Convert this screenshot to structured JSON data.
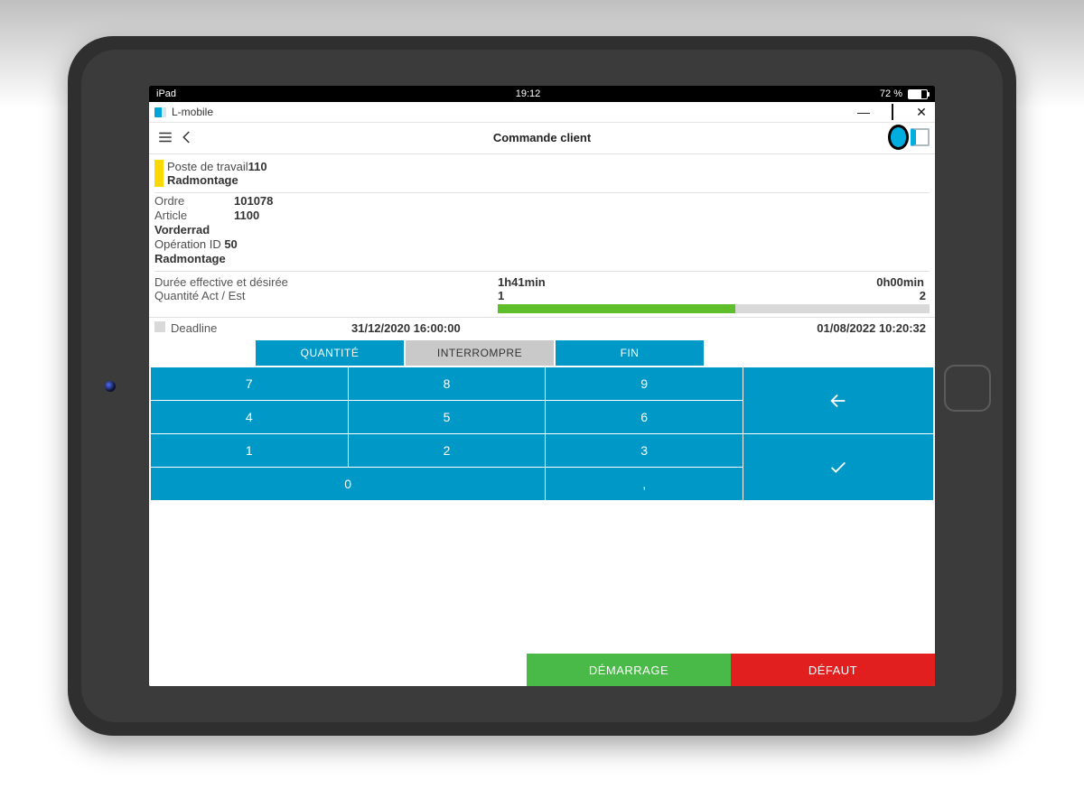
{
  "ios": {
    "device": "iPad",
    "time": "19:12",
    "battery_pct": "72 %"
  },
  "window": {
    "app_name": "L-mobile"
  },
  "header": {
    "title": "Commande client"
  },
  "workstation": {
    "label": "Poste de travail",
    "id": "110",
    "name": "Radmontage"
  },
  "order": {
    "order_label": "Ordre",
    "order_value": "101078",
    "article_label": "Article",
    "article_value": "1100",
    "article_name": "Vorderrad",
    "op_label": "Opération ID",
    "op_value": "50",
    "op_name": "Radmontage"
  },
  "duration": {
    "label": "Durée effective et désirée",
    "actual": "1h41min",
    "target": "0h00min"
  },
  "quantity": {
    "label": "Quantité Act / Est",
    "actual": "1",
    "target": "2",
    "fill_pct": 55
  },
  "deadline": {
    "label": "Deadline",
    "planned": "31/12/2020 16:00:00",
    "now": "01/08/2022 10:20:32"
  },
  "tabs": {
    "qty": "QUANTITÉ",
    "interrupt": "INTERROMPRE",
    "end": "FIN"
  },
  "keypad": {
    "k7": "7",
    "k8": "8",
    "k9": "9",
    "k4": "4",
    "k5": "5",
    "k6": "6",
    "k1": "1",
    "k2": "2",
    "k3": "3",
    "k0": "0",
    "kcomma": ","
  },
  "footer": {
    "start": "DÉMARRAGE",
    "fault": "DÉFAUT"
  }
}
